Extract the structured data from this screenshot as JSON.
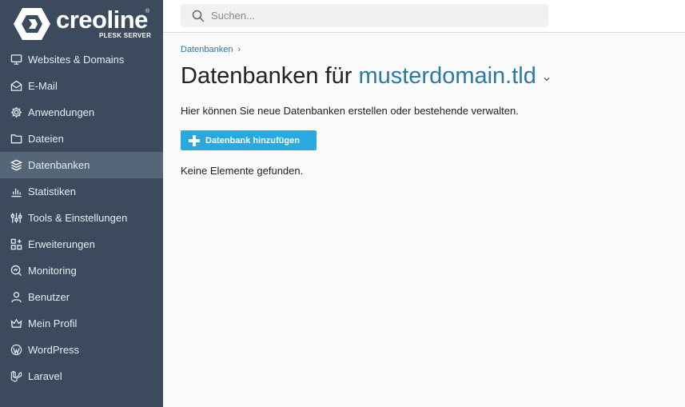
{
  "brand": {
    "name": "creoline",
    "registered": "®",
    "subtitle": "PLESK SERVER"
  },
  "search": {
    "placeholder": "Suchen..."
  },
  "sidebar": {
    "items": [
      {
        "label": "Websites & Domains",
        "icon": "monitor-icon"
      },
      {
        "label": "E-Mail",
        "icon": "mail-icon"
      },
      {
        "label": "Anwendungen",
        "icon": "gear-icon"
      },
      {
        "label": "Dateien",
        "icon": "folder-icon"
      },
      {
        "label": "Datenbanken",
        "icon": "layers-icon",
        "active": true
      },
      {
        "label": "Statistiken",
        "icon": "bar-chart-icon"
      },
      {
        "label": "Tools & Einstellungen",
        "icon": "sliders-icon"
      },
      {
        "label": "Erweiterungen",
        "icon": "grid-icon"
      },
      {
        "label": "Monitoring",
        "icon": "magnifier-chart-icon"
      },
      {
        "label": "Benutzer",
        "icon": "user-icon"
      },
      {
        "label": "Mein Profil",
        "icon": "crown-icon"
      },
      {
        "label": "WordPress",
        "icon": "wordpress-icon"
      },
      {
        "label": "Laravel",
        "icon": "laravel-icon"
      }
    ]
  },
  "main": {
    "breadcrumb": "Datenbanken",
    "title_prefix": "Datenbanken für",
    "title_domain": "musterdomain.tld",
    "description": "Hier können Sie neue Datenbanken erstellen oder bestehende verwalten.",
    "add_button_label": "Datenbank hinzufügen",
    "empty_text": "Keine Elemente gefunden."
  },
  "colors": {
    "sidebar_bg": "#3b4a5c",
    "sidebar_active": "#556678",
    "link": "#2a7aa6",
    "button": "#28a9e0"
  }
}
